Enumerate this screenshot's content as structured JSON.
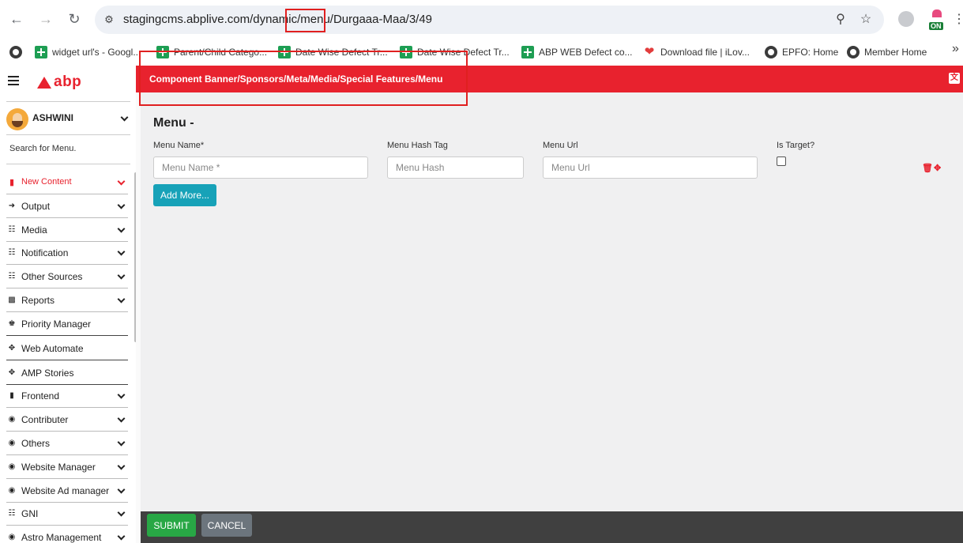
{
  "browser": {
    "url": "stagingcms.abplive.com/dynamic/menu/Durgaaa-Maa/3/49",
    "icons": [
      "back-icon",
      "forward-icon",
      "reload-icon",
      "site-settings-icon",
      "zoom-icon",
      "bookmark-star-icon",
      "extension-icon",
      "on-extension-icon",
      "more-icon"
    ]
  },
  "bookmarks": [
    {
      "label": "widget url's - Googl...",
      "icon": "globe"
    },
    {
      "label": "Parent/Child Catego...",
      "icon": "sheet"
    },
    {
      "label": "Date Wise Defect Tr...",
      "icon": "sheet"
    },
    {
      "label": "Date Wise Defect Tr...",
      "icon": "sheet"
    },
    {
      "label": "ABP WEB Defect co...",
      "icon": "sheet"
    },
    {
      "label": "Download file | iLov...",
      "icon": "heart"
    },
    {
      "label": "EPFO: Home",
      "icon": "globe"
    },
    {
      "label": "Member Home",
      "icon": "globe"
    }
  ],
  "app": {
    "logo_text": "abp",
    "breadcrumb": "Component Banner/Sponsors/Meta/Media/Special Features/Menu",
    "user_name": "ASHWINI",
    "search_placeholder": "Search for Menu.",
    "brand_color": "#e8222e"
  },
  "sidebar": {
    "items": [
      {
        "label": "New Content",
        "icon": "file-icon"
      },
      {
        "label": "Output",
        "icon": "output-icon"
      },
      {
        "label": "Media",
        "icon": "sitemap-icon"
      },
      {
        "label": "Notification",
        "icon": "sitemap-icon"
      },
      {
        "label": "Other Sources",
        "icon": "sitemap-icon"
      },
      {
        "label": "Reports",
        "icon": "chart-icon"
      },
      {
        "label": "Priority Manager",
        "icon": "trophy-icon"
      },
      {
        "label": "Web Automate",
        "icon": "move-icon"
      },
      {
        "label": "AMP Stories",
        "icon": "move-icon"
      },
      {
        "label": "Frontend",
        "icon": "doc-icon"
      },
      {
        "label": "Contributer",
        "icon": "circle-icon"
      },
      {
        "label": "Others",
        "icon": "circle-icon"
      },
      {
        "label": "Website Manager",
        "icon": "circle-icon"
      },
      {
        "label": "Website Ad manager",
        "icon": "circle-icon"
      },
      {
        "label": "GNI",
        "icon": "sitemap-icon"
      },
      {
        "label": "Astro Management",
        "icon": "circle-icon"
      }
    ]
  },
  "form": {
    "title": "Menu -",
    "labels": {
      "menu_name": "Menu Name*",
      "menu_hash": "Menu Hash Tag",
      "menu_url": "Menu Url",
      "is_target": "Is Target?"
    },
    "placeholders": {
      "menu_name": "Menu Name *",
      "menu_hash": "Menu Hash",
      "menu_url": "Menu Url"
    },
    "is_target_checked": false,
    "add_more": "Add More...",
    "submit": "SUBMIT",
    "cancel": "CANCEL"
  }
}
